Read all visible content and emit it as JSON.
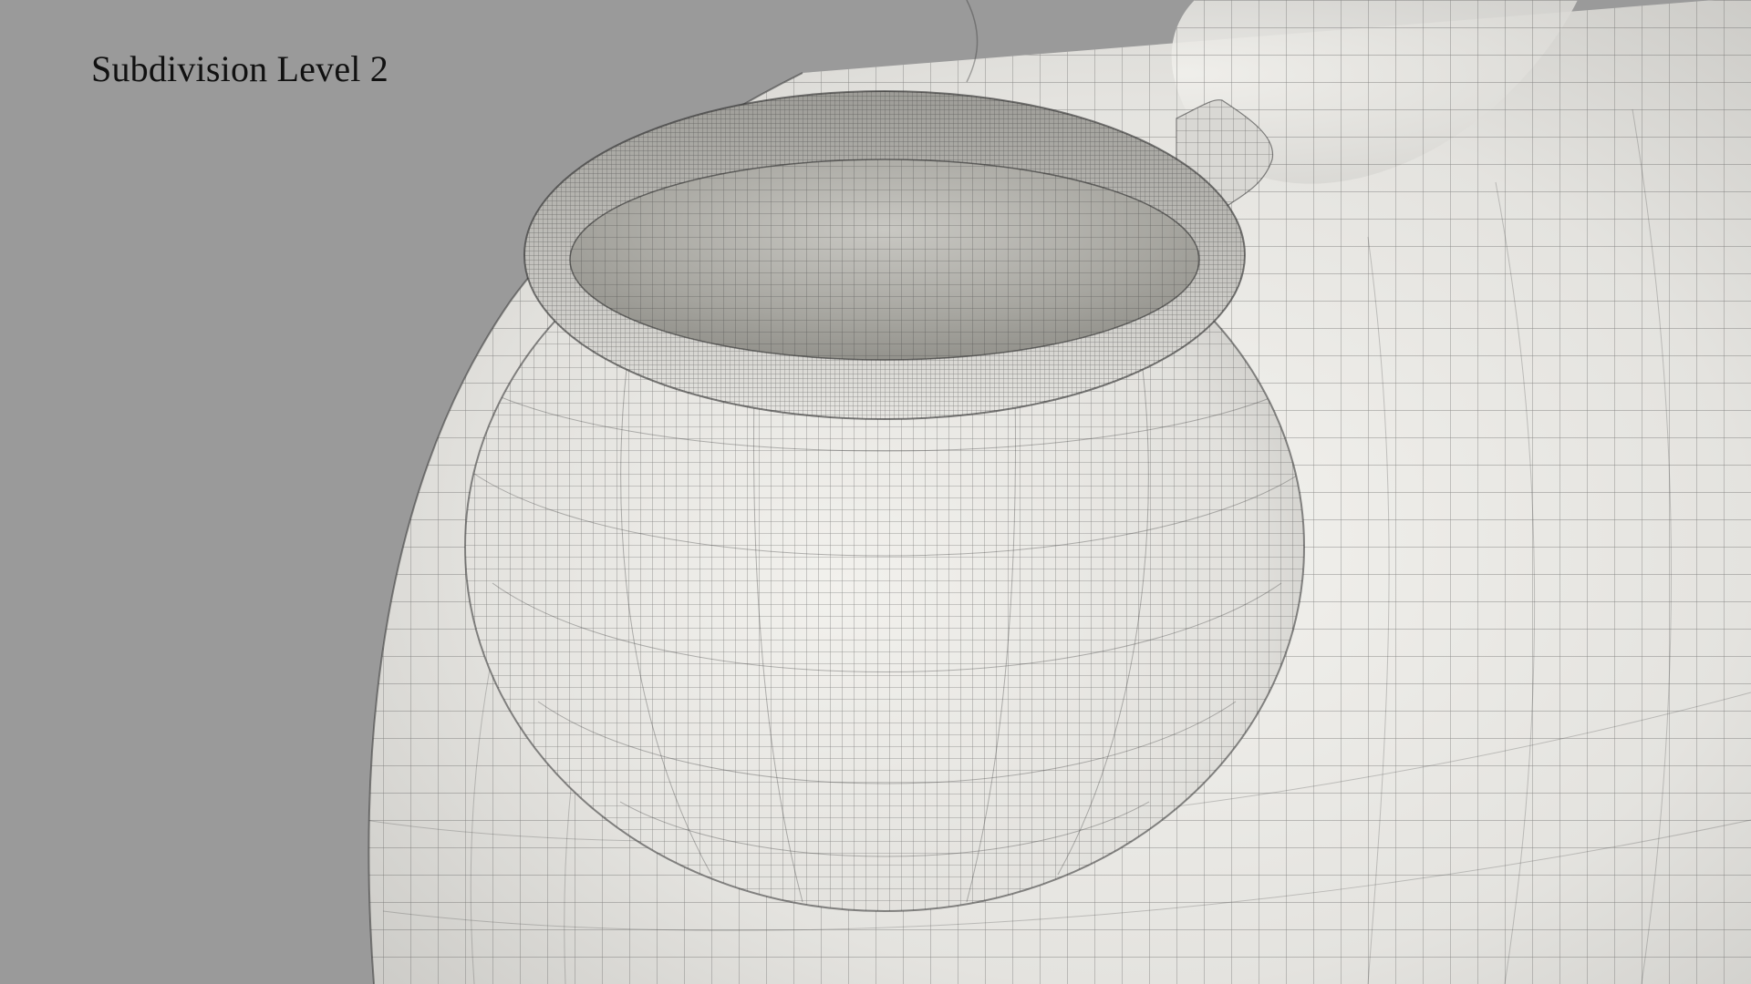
{
  "caption": {
    "text": "Subdivision Level 2"
  },
  "scene": {
    "background_color": "#9a9a9a",
    "surface_color": "#ebeae6",
    "wire_color": "#3c3c3c"
  }
}
